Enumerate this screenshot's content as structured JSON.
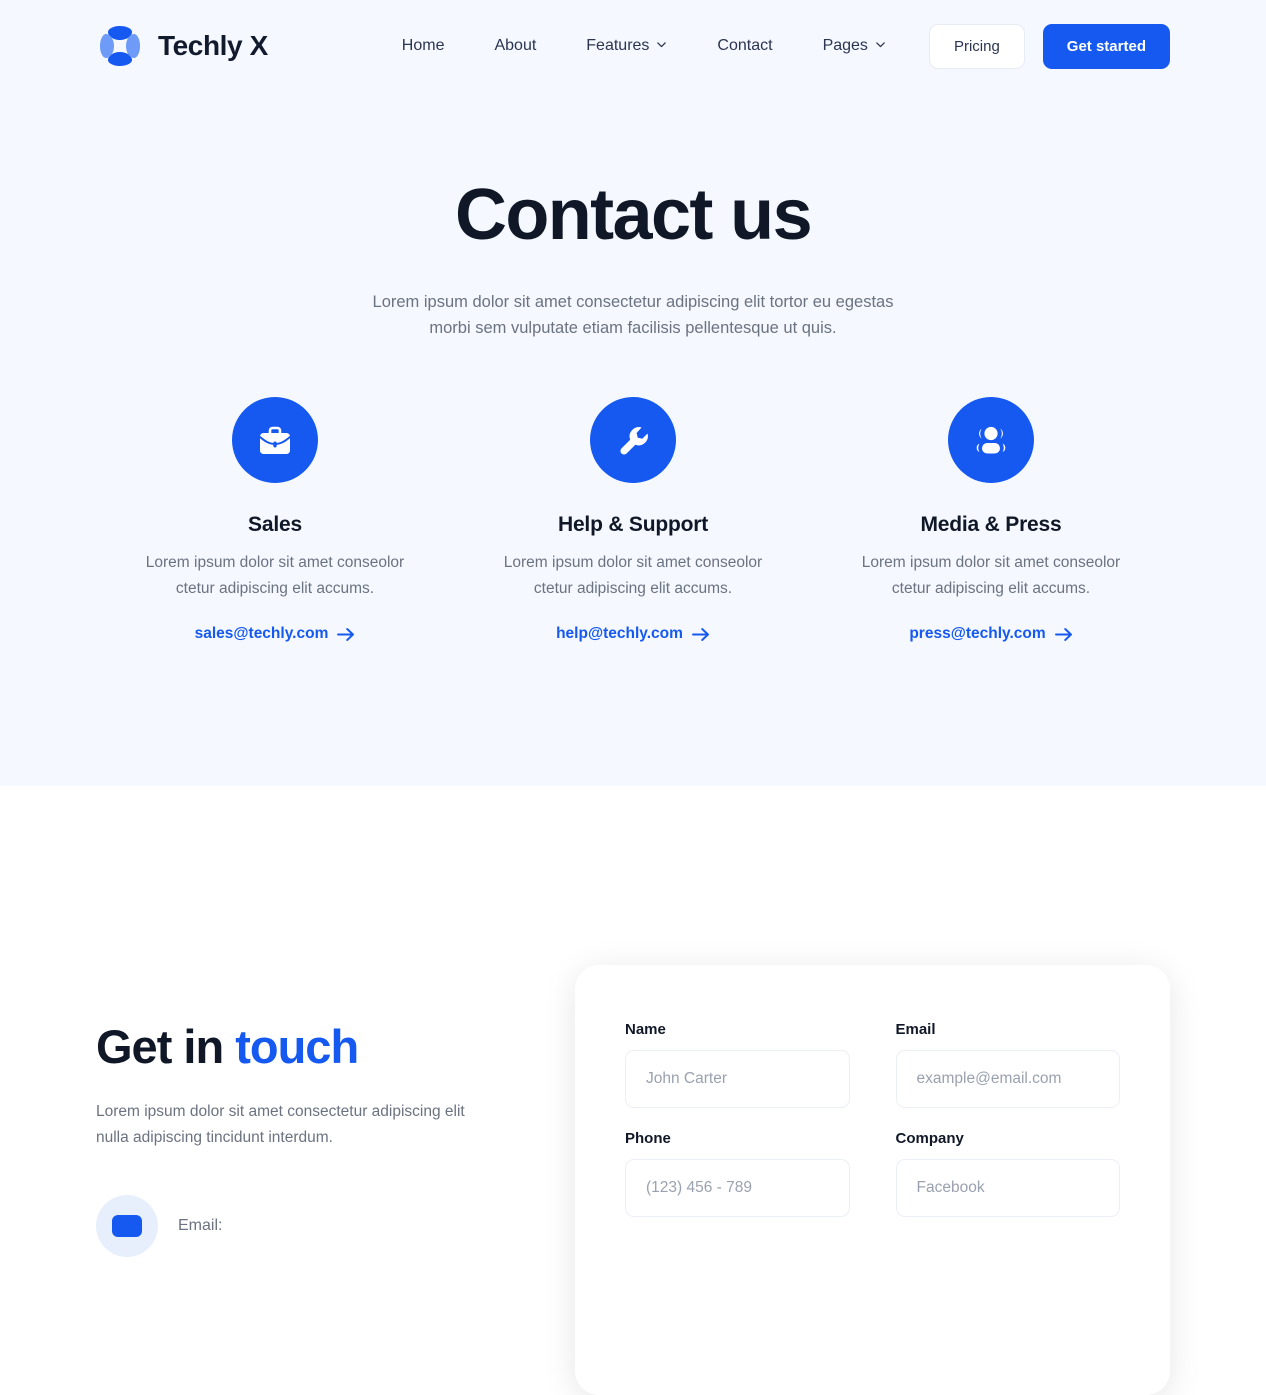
{
  "brand": {
    "name": "Techly X",
    "logo_icon": "techly-x-logo-icon",
    "logo_colors": {
      "dark": "#1559f0",
      "light": "#6d9bf7"
    }
  },
  "nav": {
    "links": [
      {
        "label": "Home",
        "has_caret": false
      },
      {
        "label": "About",
        "has_caret": false
      },
      {
        "label": "Features",
        "has_caret": true
      },
      {
        "label": "Contact",
        "has_caret": false
      },
      {
        "label": "Pages",
        "has_caret": true
      }
    ],
    "pricing_label": "Pricing",
    "get_started_label": "Get started",
    "accent_color": "#1559f0"
  },
  "hero": {
    "title": "Contact us",
    "subtitle": "Lorem ipsum dolor sit amet consectetur adipiscing elit tortor eu egestas morbi sem vulputate etiam facilisis pellentesque ut quis.",
    "background_color": "#f5f8ff"
  },
  "contact_cards": [
    {
      "icon": "briefcase-icon",
      "title": "Sales",
      "description": "Lorem ipsum dolor sit amet conseolor ctetur adipiscing elit accums.",
      "email": "sales@techly.com",
      "arrow_icon": "arrow-right-icon"
    },
    {
      "icon": "wrench-icon",
      "title": "Help & Support",
      "description": "Lorem ipsum dolor sit amet conseolor ctetur adipiscing elit accums.",
      "email": "help@techly.com",
      "arrow_icon": "arrow-right-icon"
    },
    {
      "icon": "users-group-icon",
      "title": "Media & Press",
      "description": "Lorem ipsum dolor sit amet conseolor ctetur adipiscing elit accums.",
      "email": "press@techly.com",
      "arrow_icon": "arrow-right-icon"
    }
  ],
  "get_in_touch": {
    "title_plain": "Get in ",
    "title_accent": "touch",
    "description": "Lorem ipsum dolor sit amet consectetur adipiscing elit nulla adipiscing tincidunt interdum.",
    "contact_items": [
      {
        "icon": "envelope-icon",
        "label": "Email:"
      }
    ]
  },
  "form": {
    "fields": [
      {
        "label": "Name",
        "value": "",
        "placeholder": "John Carter",
        "name": "name-field"
      },
      {
        "label": "Email",
        "value": "",
        "placeholder": "example@email.com",
        "name": "email-field"
      },
      {
        "label": "Phone",
        "value": "",
        "placeholder": "(123) 456 - 789",
        "name": "phone-field"
      },
      {
        "label": "Company",
        "value": "",
        "placeholder": "Facebook",
        "name": "company-field"
      }
    ]
  }
}
